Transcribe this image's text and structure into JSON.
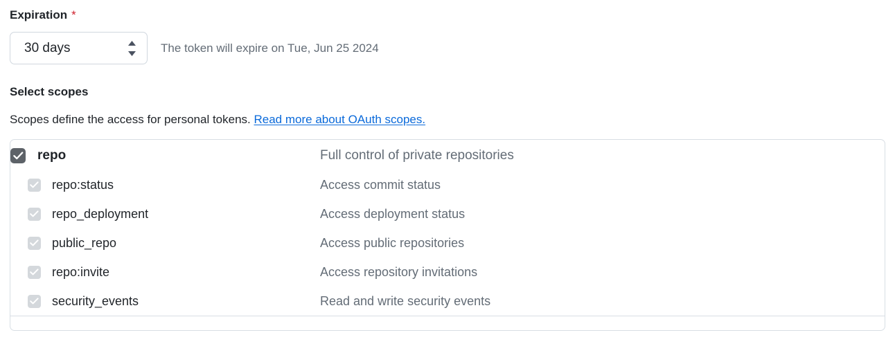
{
  "expiration": {
    "label": "Expiration",
    "required_marker": "*",
    "select": {
      "value": "30 days",
      "icon": "stepper-updown-icon"
    },
    "note": "The token will expire on Tue, Jun 25 2024"
  },
  "scopes_section": {
    "title": "Select scopes",
    "description_prefix": "Scopes define the access for personal tokens.",
    "link_text": "Read more about OAuth scopes."
  },
  "scope_groups": [
    {
      "parent": {
        "name": "repo",
        "description": "Full control of private repositories",
        "checked": true,
        "checkbox_state": "checked"
      },
      "children": [
        {
          "name": "repo:status",
          "description": "Access commit status",
          "checked": true,
          "checkbox_state": "checked-disabled"
        },
        {
          "name": "repo_deployment",
          "description": "Access deployment status",
          "checked": true,
          "checkbox_state": "checked-disabled"
        },
        {
          "name": "public_repo",
          "description": "Access public repositories",
          "checked": true,
          "checkbox_state": "checked-disabled"
        },
        {
          "name": "repo:invite",
          "description": "Access repository invitations",
          "checked": true,
          "checkbox_state": "checked-disabled"
        },
        {
          "name": "security_events",
          "description": "Read and write security events",
          "checked": true,
          "checkbox_state": "checked-disabled"
        }
      ]
    }
  ],
  "colors": {
    "text": "#1f2328",
    "muted": "#636c76",
    "link": "#0969da",
    "required": "#cf222e",
    "border": "#d8dee4",
    "checkbox_checked": "#5d6268",
    "checkbox_disabled": "#d4d8dc"
  }
}
